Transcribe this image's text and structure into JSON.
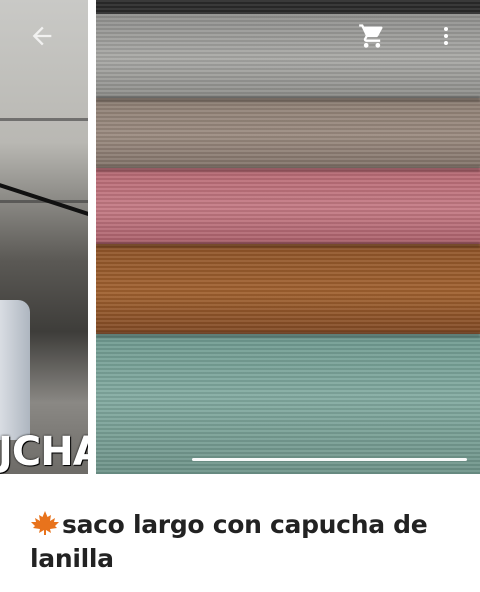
{
  "app_bar": {
    "back_icon": "arrow-left-icon",
    "cart_icon": "shopping-cart-icon",
    "menu_icon": "more-vert-icon"
  },
  "gallery": {
    "previous_image_caption": "JCHA",
    "image_count": 2,
    "current_image_index": 1,
    "swatch_colors": [
      "#2a2a2a",
      "#a0a09d",
      "#958579",
      "#c07580",
      "#9a5c2d",
      "#7ea69c"
    ]
  },
  "product": {
    "emoji_icon": "maple-leaf-icon",
    "title": "saco largo con capucha de lanilla"
  },
  "colors": {
    "text": "#222222",
    "background": "#ffffff",
    "leaf": "#e8731c"
  }
}
